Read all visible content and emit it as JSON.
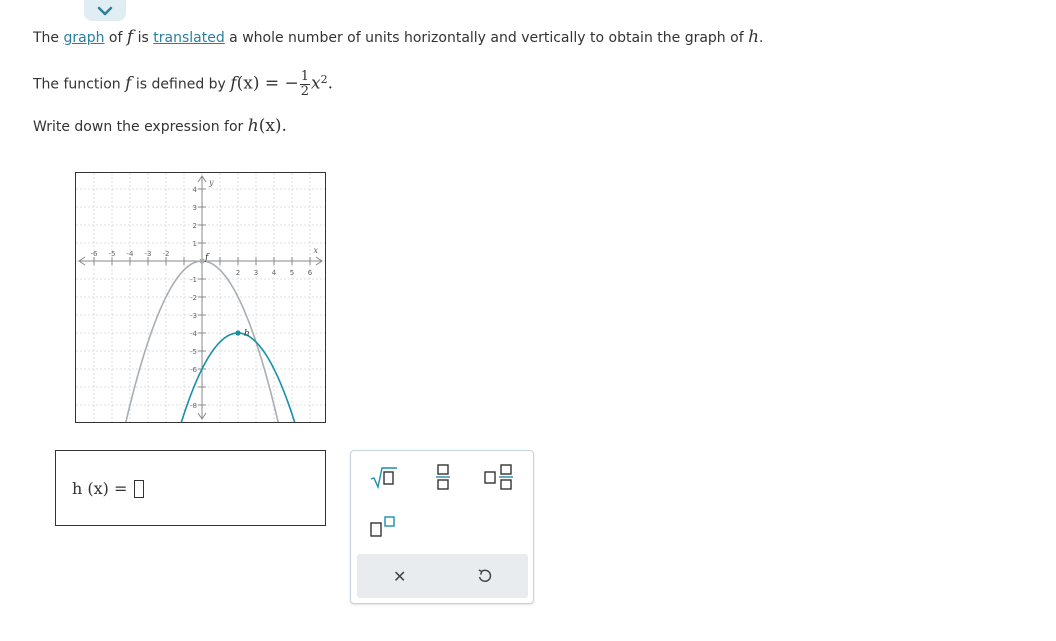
{
  "question": {
    "line1": {
      "t1": "The ",
      "link_graph": "graph",
      "t2": " of ",
      "f": "f",
      "t3": " is ",
      "link_translated": "translated",
      "t4": " a whole number of units horizontally and vertically to obtain the graph of ",
      "h": "h",
      "t5": "."
    },
    "line2": {
      "t1": "The function ",
      "f": "f",
      "t2": " is defined by ",
      "fx": "f",
      "paren_x": "(x)",
      "eq": " = −",
      "num": "1",
      "den": "2",
      "var": "x",
      "exp": "2",
      "end": "."
    },
    "line3": {
      "t1": "Write down the expression for ",
      "h": "h",
      "paren_x": "(x)",
      "end": "."
    }
  },
  "graph": {
    "x_axis_label": "x",
    "y_axis_label": "y",
    "x_ticks": [
      "-6",
      "-5",
      "-4",
      "-3",
      "-2",
      "2",
      "3",
      "4",
      "5",
      "6"
    ],
    "y_ticks": [
      "4",
      "3",
      "2",
      "1",
      "-1",
      "-2",
      "-3",
      "-4",
      "-5",
      "-6",
      "-8"
    ],
    "curve_f_label": "f",
    "curve_h_label": "h",
    "colors": {
      "f": "#a8aeb3",
      "h": "#1a8fa8",
      "axis": "#888888",
      "grid": "#d5d5d5"
    }
  },
  "answer": {
    "label": "h (x)  =",
    "input_value": ""
  },
  "palette": {
    "buttons": [
      "sqrt-icon",
      "fraction-icon",
      "mixed-number-icon",
      "superscript-icon"
    ],
    "clear_icon": "✕",
    "undo_icon": "undo-icon"
  },
  "collapse_icon": "chevron-down-icon"
}
